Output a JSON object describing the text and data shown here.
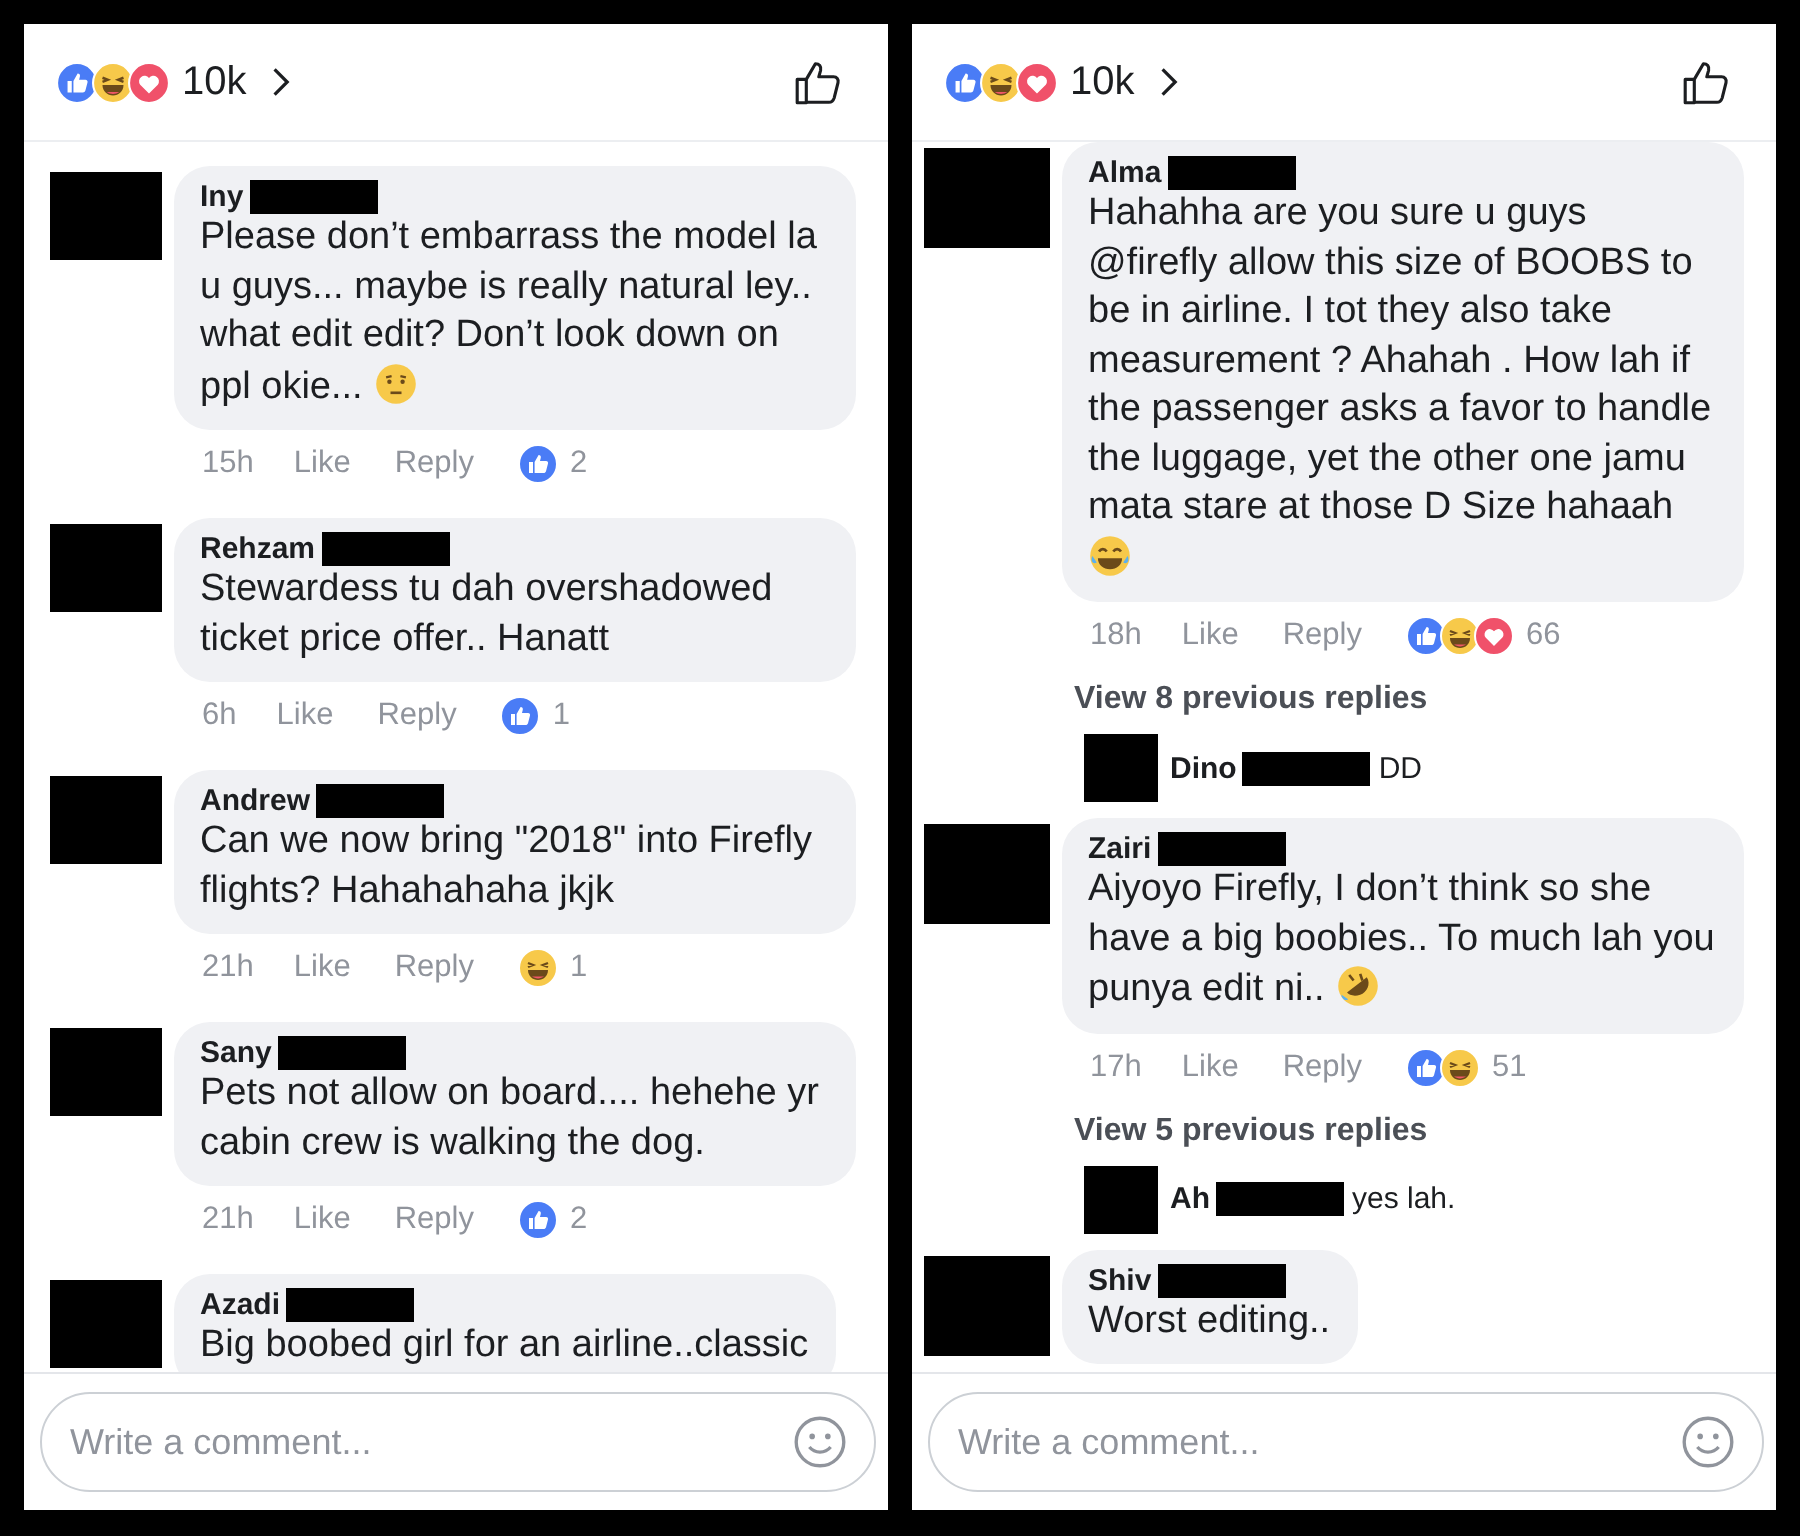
{
  "panels": [
    {
      "reactions": [
        {
          "kind": "like"
        },
        {
          "kind": "haha"
        },
        {
          "kind": "love"
        }
      ],
      "reaction_count": "10k",
      "comments": [
        {
          "kind": "comment",
          "author": "Iny",
          "text": "Please don’t embarrass the model la u guys... maybe is really natural ley.. what edit edit? Don’t look down on ppl okie...",
          "emoji": {
            "kind": "smirk"
          },
          "time": "15h",
          "like": "Like",
          "reply": "Reply",
          "reactions": [
            {
              "kind": "like"
            }
          ],
          "reaction_count": "2"
        },
        {
          "kind": "comment",
          "author": "Rehzam",
          "text": "Stewardess tu dah overshadowed ticket price offer.. Hanatt",
          "time": "6h",
          "like": "Like",
          "reply": "Reply",
          "reactions": [
            {
              "kind": "like"
            }
          ],
          "reaction_count": "1"
        },
        {
          "kind": "comment",
          "author": "Andrew",
          "text": "Can we now bring \"2018\" into Firefly flights? Hahahahaha jkjk",
          "time": "21h",
          "like": "Like",
          "reply": "Reply",
          "reactions": [
            {
              "kind": "haha"
            }
          ],
          "reaction_count": "1"
        },
        {
          "kind": "comment",
          "author": "Sany",
          "text": "Pets not allow on board.... hehehe yr cabin crew is walking the dog.",
          "time": "21h",
          "like": "Like",
          "reply": "Reply",
          "reactions": [
            {
              "kind": "like"
            }
          ],
          "reaction_count": "2"
        },
        {
          "kind": "comment",
          "author": "Azadi",
          "text": "Big boobed girl for an airline..classic"
        }
      ],
      "composer": {
        "placeholder": "Write a comment..."
      }
    },
    {
      "reactions": [
        {
          "kind": "like"
        },
        {
          "kind": "haha"
        },
        {
          "kind": "love"
        }
      ],
      "reaction_count": "10k",
      "comments": [
        {
          "kind": "comment",
          "author": "Alma",
          "text": "Hahahha are you sure u guys @firefly allow this size of BOOBS to be in airline. I tot they also take measurement ? Ahahah . How lah if the passenger asks a favor to handle the luggage, yet the other one jamu mata stare at those D Size hahaah",
          "emoji": {
            "kind": "tears"
          },
          "time": "18h",
          "like": "Like",
          "reply": "Reply",
          "reactions": [
            {
              "kind": "like"
            },
            {
              "kind": "haha"
            },
            {
              "kind": "love"
            }
          ],
          "reaction_count": "66"
        },
        {
          "kind": "more",
          "text": "View 8 previous replies"
        },
        {
          "kind": "reply",
          "author": "Dino",
          "text": "DD"
        },
        {
          "kind": "comment",
          "author": "Zairi",
          "text": "Aiyoyo Firefly, I don’t think so she have a big boobies.. To much lah you punya edit ni..",
          "emoji": {
            "kind": "rofl"
          },
          "time": "17h",
          "like": "Like",
          "reply": "Reply",
          "reactions": [
            {
              "kind": "like"
            },
            {
              "kind": "haha"
            }
          ],
          "reaction_count": "51"
        },
        {
          "kind": "more",
          "text": "View 5 previous replies"
        },
        {
          "kind": "reply",
          "author": "Ah",
          "text": "yes lah."
        },
        {
          "kind": "comment",
          "author": "Shiv",
          "text": "Worst editing.."
        }
      ],
      "composer": {
        "placeholder": "Write a comment..."
      }
    }
  ]
}
